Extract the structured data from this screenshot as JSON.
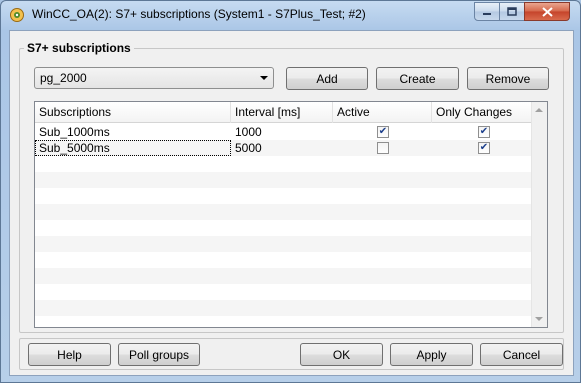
{
  "window": {
    "title": "WinCC_OA(2): S7+ subscriptions (System1 - S7Plus_Test; #2)",
    "min_icon": "minimize-icon",
    "max_icon": "maximize-icon",
    "close_icon": "close-icon",
    "app_icon": "wincc-oa-icon"
  },
  "group": {
    "title": "S7+ subscriptions"
  },
  "poll_group_select": {
    "value": "pg_2000"
  },
  "toolbar": {
    "add": "Add",
    "create": "Create",
    "remove": "Remove"
  },
  "table": {
    "columns": [
      "Subscriptions",
      "Interval [ms]",
      "Active",
      "Only Changes"
    ],
    "rows": [
      {
        "name": "Sub_1000ms",
        "interval": "1000",
        "active": true,
        "only_changes": true
      },
      {
        "name": "Sub_5000ms",
        "interval": "5000",
        "active": false,
        "only_changes": true
      }
    ]
  },
  "footer": {
    "help": "Help",
    "poll_groups": "Poll groups",
    "ok": "OK",
    "apply": "Apply",
    "cancel": "Cancel"
  },
  "colors": {
    "accent": "#1c3f8c",
    "close_red": "#c5432a"
  }
}
